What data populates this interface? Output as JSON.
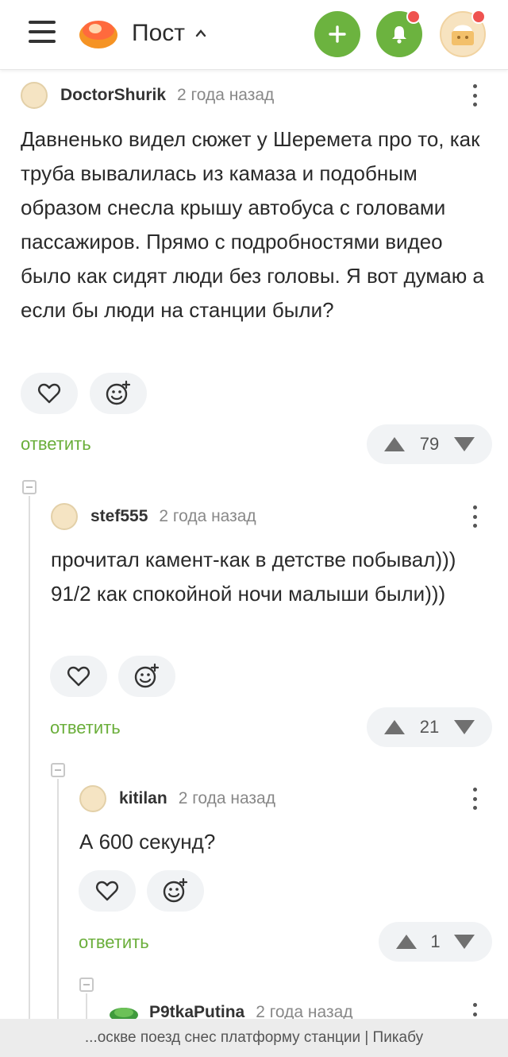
{
  "header": {
    "title": "Пост",
    "icons": {
      "menu": "menu-icon",
      "logo": "pikabu-logo",
      "caret": "chevron-up-icon",
      "add": "plus-icon",
      "bell": "bell-icon",
      "avatar": "user-avatar"
    },
    "accent": "#6cb33f",
    "badge_color": "#ef5350"
  },
  "comments": [
    {
      "author": "DoctorShurik",
      "time": "2 года назад",
      "text": "Давненько видел сюжет у Шеремета про то, как труба вывалилась из камаза и подобным образом снесла крышу автобуса с головами пассажиров. Прямо с подробностями видео было как сидят люди без головы. Я вот думаю а если бы люди на станции были?",
      "reply_label": "ответить",
      "rating": "79"
    },
    {
      "author": "stef555",
      "time": "2 года назад",
      "text": "прочитал камент-как в детстве побывал))) 91/2 как спокойной ночи малыши были)))",
      "reply_label": "ответить",
      "rating": "21"
    },
    {
      "author": "kitilan",
      "time": "2 года назад",
      "text": "А 600 секунд?",
      "reply_label": "ответить",
      "rating": "1"
    },
    {
      "author": "P9tkaPutina",
      "time": "2 года назад"
    }
  ],
  "footer": {
    "page_title": "...оскве поезд снес платформу станции | Пикабу"
  }
}
